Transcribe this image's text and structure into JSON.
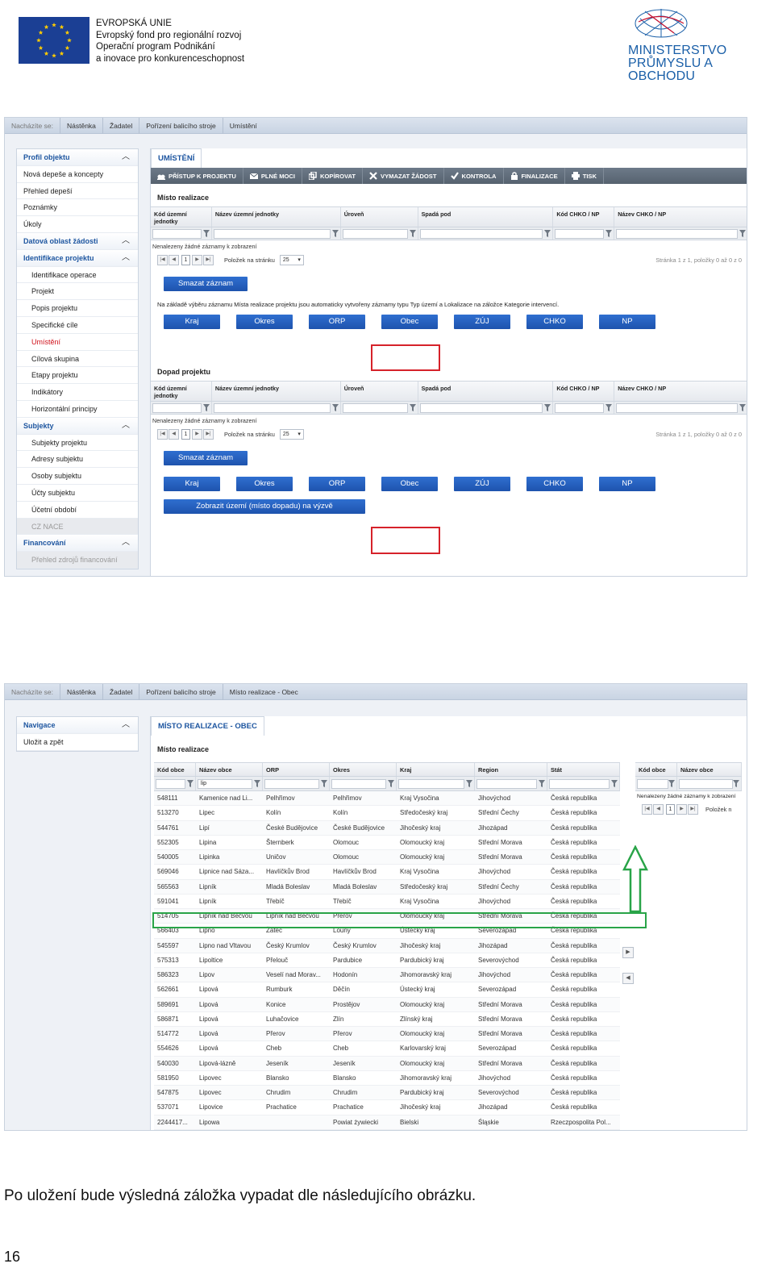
{
  "header": {
    "eu_lines": [
      "EVROPSKÁ UNIE",
      "Evropský fond pro regionální rozvoj",
      "Operační program Podnikání",
      "a inovace pro konkurenceschopnost"
    ],
    "mpo_lines": [
      "MINISTERSTVO",
      "PRŮMYSLU A OBCHODU"
    ]
  },
  "shot1": {
    "breadcrumb": [
      "Nacházíte se:",
      "Nástěnka",
      "Žadatel",
      "Pořízení balicího stroje",
      "Umístění"
    ],
    "sidebar": [
      {
        "label": "Profil objektu",
        "type": "sec"
      },
      {
        "label": "Nová depeše a koncepty",
        "type": "item"
      },
      {
        "label": "Přehled depeší",
        "type": "item"
      },
      {
        "label": "Poznámky",
        "type": "item"
      },
      {
        "label": "Úkoly",
        "type": "item"
      },
      {
        "label": "Datová oblast žádosti",
        "type": "sec"
      },
      {
        "label": "Identifikace projektu",
        "type": "sec2"
      },
      {
        "label": "Identifikace operace",
        "type": "sub"
      },
      {
        "label": "Projekt",
        "type": "sub"
      },
      {
        "label": "Popis projektu",
        "type": "sub"
      },
      {
        "label": "Specifické cíle",
        "type": "sub"
      },
      {
        "label": "Umístění",
        "type": "active"
      },
      {
        "label": "Cílová skupina",
        "type": "sub"
      },
      {
        "label": "Etapy projektu",
        "type": "sub"
      },
      {
        "label": "Indikátory",
        "type": "sub"
      },
      {
        "label": "Horizontální principy",
        "type": "sub"
      },
      {
        "label": "Subjekty",
        "type": "sec2"
      },
      {
        "label": "Subjekty projektu",
        "type": "sub"
      },
      {
        "label": "Adresy subjektu",
        "type": "sub"
      },
      {
        "label": "Osoby subjektu",
        "type": "sub"
      },
      {
        "label": "Účty subjektu",
        "type": "sub"
      },
      {
        "label": "Účetní období",
        "type": "sub"
      },
      {
        "label": "CZ NACE",
        "type": "dis"
      },
      {
        "label": "Financování",
        "type": "sec2"
      },
      {
        "label": "Přehled zdrojů financování",
        "type": "dis"
      }
    ],
    "tab": "UMÍSTĚNÍ",
    "toolbar": [
      {
        "label": "PŘÍSTUP K PROJEKTU",
        "icon": "users-icon"
      },
      {
        "label": "PLNÉ MOCI",
        "icon": "mail-icon"
      },
      {
        "label": "KOPÍROVAT",
        "icon": "copy-icon"
      },
      {
        "label": "VYMAZAT ŽÁDOST",
        "icon": "x-icon"
      },
      {
        "label": "KONTROLA",
        "icon": "check-icon"
      },
      {
        "label": "FINALIZACE",
        "icon": "lock-icon"
      },
      {
        "label": "TISK",
        "icon": "printer-icon"
      }
    ],
    "columns": [
      "Kód územní jednotky",
      "Název územní jednotky",
      "Úroveň",
      "Spadá pod",
      "Kód CHKO / NP",
      "Název CHKO / NP"
    ],
    "section1_title": "Místo realizace",
    "section2_title": "Dopad projektu",
    "empty_msg": "Nenalezeny žádné záznamy k zobrazení",
    "pager_page": "1",
    "pager_size_label": "Položek na stránku",
    "pager_size": "25",
    "pager_info": "Stránka 1 z 1, položky 0 až 0 z 0",
    "delete_btn": "Smazat záznam",
    "note": "Na základě výběru záznamu Místa realizace projektu jsou automaticky vytvořeny záznamy typu Typ území a Lokalizace na záložce Kategorie intervencí.",
    "level_buttons": [
      "Kraj",
      "Okres",
      "ORP",
      "Obec",
      "ZÚJ",
      "CHKO",
      "NP"
    ],
    "show_btn": "Zobrazit území (místo dopadu) na výzvě"
  },
  "shot2": {
    "breadcrumb": [
      "Nacházíte se:",
      "Nástěnka",
      "Žadatel",
      "Pořízení balicího stroje",
      "Místo realizace - Obec"
    ],
    "nav_title": "Navigace",
    "nav_item": "Uložit a zpět",
    "tab": "MÍSTO REALIZACE - OBEC",
    "section_title": "Místo realizace",
    "columns": [
      "Kód obce",
      "Název obce",
      "ORP",
      "Okres",
      "Kraj",
      "Region",
      "Stát"
    ],
    "filter_value": "lip",
    "rows": [
      [
        "548111",
        "Kamenice nad Li...",
        "Pelhřimov",
        "Pelhřimov",
        "Kraj Vysočina",
        "Jihovýchod",
        "Česká republika"
      ],
      [
        "513270",
        "Lipec",
        "Kolín",
        "Kolín",
        "Středočeský kraj",
        "Střední Čechy",
        "Česká republika"
      ],
      [
        "544761",
        "Lipí",
        "České Budějovice",
        "České Budějovice",
        "Jihočeský kraj",
        "Jihozápad",
        "Česká republika"
      ],
      [
        "552305",
        "Lipina",
        "Šternberk",
        "Olomouc",
        "Olomoucký kraj",
        "Střední Morava",
        "Česká republika"
      ],
      [
        "540005",
        "Lipinka",
        "Uničov",
        "Olomouc",
        "Olomoucký kraj",
        "Střední Morava",
        "Česká republika"
      ],
      [
        "569046",
        "Lipnice nad Sáza...",
        "Havlíčkův Brod",
        "Havlíčkův Brod",
        "Kraj Vysočina",
        "Jihovýchod",
        "Česká republika"
      ],
      [
        "565563",
        "Lipník",
        "Mladá Boleslav",
        "Mladá Boleslav",
        "Středočeský kraj",
        "Střední Čechy",
        "Česká republika"
      ],
      [
        "591041",
        "Lipník",
        "Třebíč",
        "Třebíč",
        "Kraj Vysočina",
        "Jihovýchod",
        "Česká republika"
      ],
      [
        "514705",
        "Lipník nad Bečvou",
        "Lipník nad Bečvou",
        "Přerov",
        "Olomoucký kraj",
        "Střední Morava",
        "Česká republika"
      ],
      [
        "566403",
        "Lipno",
        "Žatec",
        "Louny",
        "Ústecký kraj",
        "Severozápad",
        "Česká republika"
      ],
      [
        "545597",
        "Lipno nad Vltavou",
        "Český Krumlov",
        "Český Krumlov",
        "Jihočeský kraj",
        "Jihozápad",
        "Česká republika"
      ],
      [
        "575313",
        "Lipoltice",
        "Přelouč",
        "Pardubice",
        "Pardubický kraj",
        "Severovýchod",
        "Česká republika"
      ],
      [
        "586323",
        "Lipov",
        "Veselí nad Morav...",
        "Hodonín",
        "Jihomoravský kraj",
        "Jihovýchod",
        "Česká republika"
      ],
      [
        "562661",
        "Lipová",
        "Rumburk",
        "Děčín",
        "Ústecký kraj",
        "Severozápad",
        "Česká republika"
      ],
      [
        "589691",
        "Lipová",
        "Konice",
        "Prostějov",
        "Olomoucký kraj",
        "Střední Morava",
        "Česká republika"
      ],
      [
        "586871",
        "Lipová",
        "Luhačovice",
        "Zlín",
        "Zlínský kraj",
        "Střední Morava",
        "Česká republika"
      ],
      [
        "514772",
        "Lipová",
        "Přerov",
        "Přerov",
        "Olomoucký kraj",
        "Střední Morava",
        "Česká republika"
      ],
      [
        "554626",
        "Lipová",
        "Cheb",
        "Cheb",
        "Karlovarský kraj",
        "Severozápad",
        "Česká republika"
      ],
      [
        "540030",
        "Lipová-lázně",
        "Jeseník",
        "Jeseník",
        "Olomoucký kraj",
        "Střední Morava",
        "Česká republika"
      ],
      [
        "581950",
        "Lipovec",
        "Blansko",
        "Blansko",
        "Jihomoravský kraj",
        "Jihovýchod",
        "Česká republika"
      ],
      [
        "547875",
        "Lipovec",
        "Chrudim",
        "Chrudim",
        "Pardubický kraj",
        "Severovýchod",
        "Česká republika"
      ],
      [
        "537071",
        "Lipovice",
        "Prachatice",
        "Prachatice",
        "Jihočeský kraj",
        "Jihozápad",
        "Česká republika"
      ],
      [
        "2244417...",
        "Lipowa",
        "",
        "Powiat żywiecki",
        "Bielski",
        "Śląskie",
        "Rzeczpospolita Pol..."
      ]
    ],
    "right_columns": [
      "Kód obce",
      "Název obce"
    ],
    "right_empty_msg": "Nenalezeny žádné záznamy k zobrazení",
    "right_page": "1",
    "right_size_label": "Položek n"
  },
  "caption": "Po uložení bude výsledná záložka vypadat dle následujícího obrázku.",
  "page_number": "16",
  "colors": {
    "accent": "#1e56a0",
    "button": "#2a66c8",
    "highlight_red": "#d6222a",
    "highlight_green": "#29a448"
  }
}
